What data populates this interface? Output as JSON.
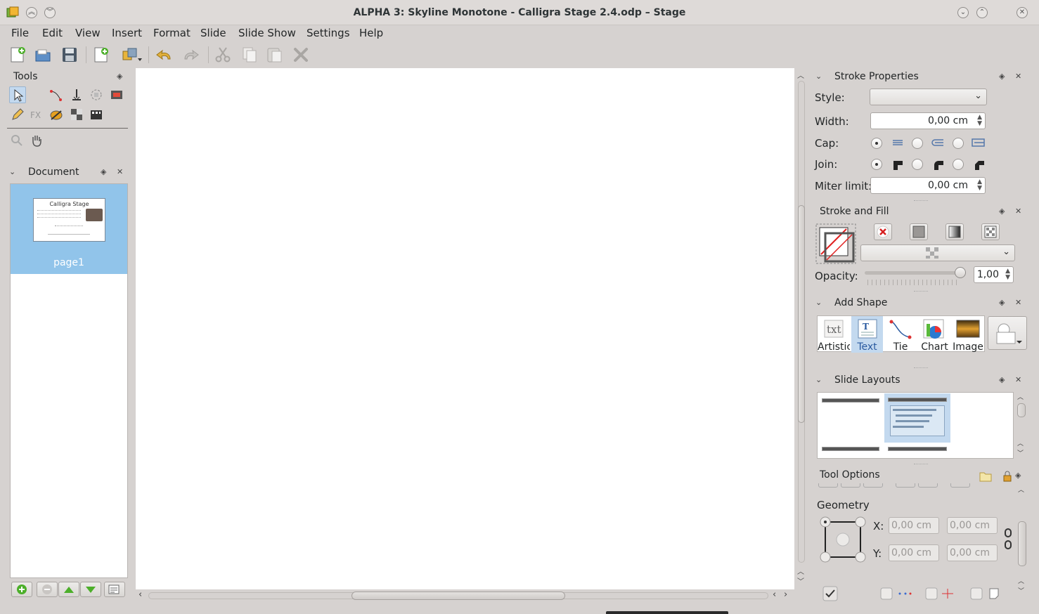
{
  "window": {
    "title": "ALPHA 3: Skyline Monotone - Calligra Stage 2.4.odp – Stage"
  },
  "menu": [
    "File",
    "Edit",
    "View",
    "Insert",
    "Format",
    "Slide",
    "Slide Show",
    "Settings",
    "Help"
  ],
  "toolbar": {
    "icons": [
      "new-document-icon",
      "open-document-icon",
      "save-icon",
      "insert-page-icon",
      "arrange-icon",
      "undo-icon",
      "redo-icon",
      "cut-icon",
      "copy-icon",
      "paste-icon",
      "delete-icon"
    ]
  },
  "tools_panel": {
    "title": "Tools"
  },
  "document_panel": {
    "title": "Document",
    "page_label": "page1",
    "thumb_title": "Calligra Stage"
  },
  "stroke_properties": {
    "title": "Stroke Properties",
    "style_label": "Style:",
    "width_label": "Width:",
    "width_value": "0,00 cm",
    "cap_label": "Cap:",
    "join_label": "Join:",
    "miter_label": "Miter limit:",
    "miter_value": "0,00 cm"
  },
  "stroke_fill": {
    "title": "Stroke and Fill",
    "opacity_label": "Opacity:",
    "opacity_value": "1,00",
    "opacity": 1.0
  },
  "add_shape": {
    "title": "Add Shape",
    "items": [
      "Artistic",
      "Text",
      "Tie",
      "Chart",
      "Image"
    ]
  },
  "slide_layouts": {
    "title": "Slide Layouts"
  },
  "tool_options": {
    "title": "Tool Options",
    "geometry_label": "Geometry",
    "x_label": "X:",
    "y_label": "Y:",
    "x_value": "0,00 cm",
    "x2_value": "0,00 cm",
    "y_value": "0,00 cm",
    "y2_value": "0,00 cm"
  },
  "colors": {
    "accent": "#91c4ea",
    "window_bg": "#d6d2d0",
    "canvas": "#ffffff"
  }
}
